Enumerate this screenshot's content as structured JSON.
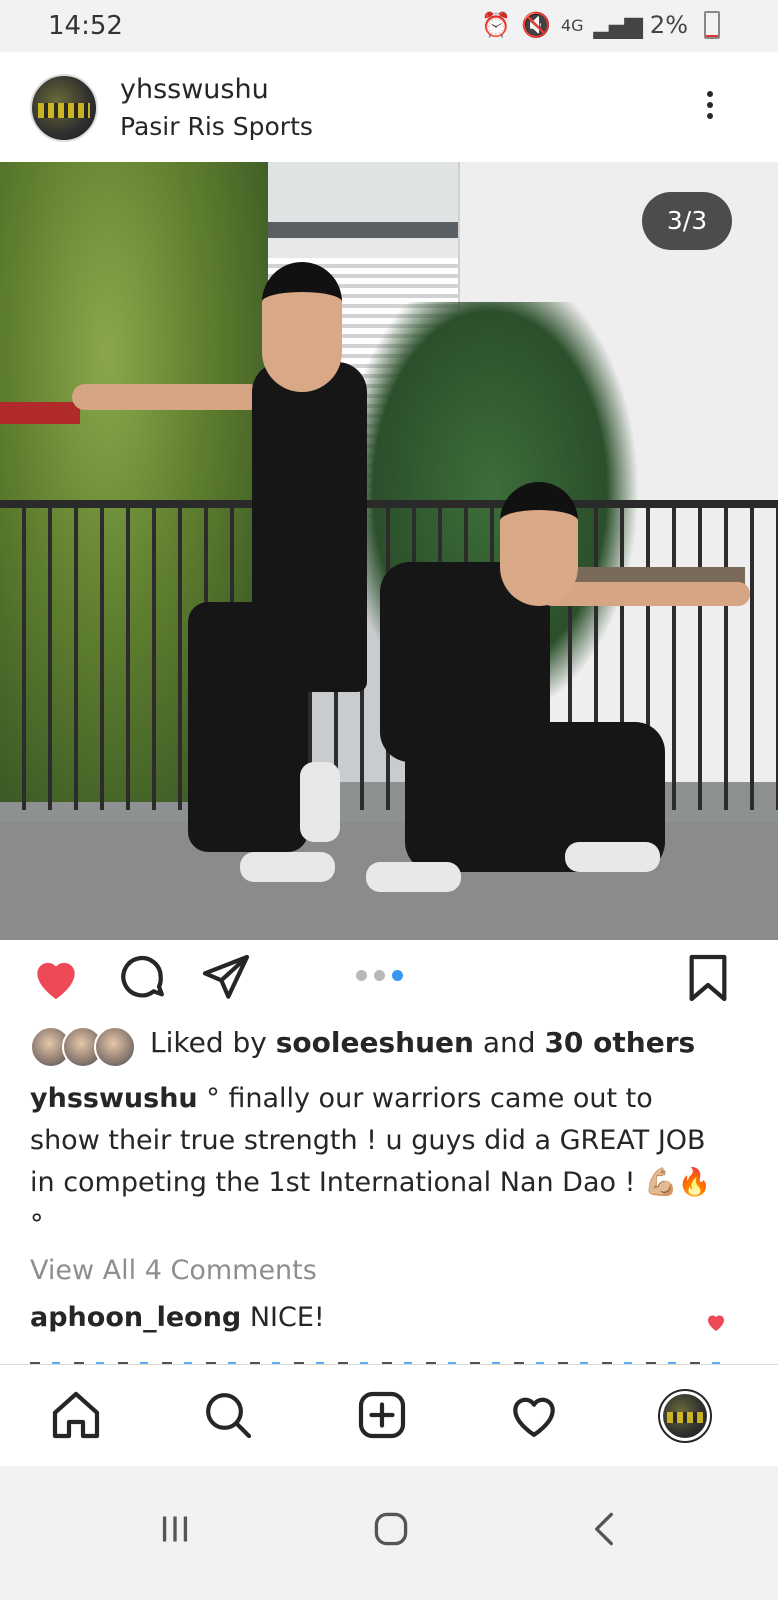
{
  "status_bar": {
    "time": "14:52",
    "network": "4G",
    "battery": "2%"
  },
  "post": {
    "username": "yhsswushu",
    "location": "Pasir Ris Sports",
    "photo_counter": "3/3",
    "carousel": {
      "total": 3,
      "current": 3
    },
    "liked": true,
    "likes": {
      "prefix": "Liked by",
      "user": "sooleeshuen",
      "middle": "and",
      "others": "30 others"
    },
    "caption": {
      "username": "yhsswushu",
      "text": "° finally our warriors came out to show their true strength ! u guys did a GREAT JOB in competing the 1st International Nan Dao ! 💪🏼🔥 °"
    },
    "view_all_comments": "View All 4 Comments",
    "comments": [
      {
        "username": "aphoon_leong",
        "text": "NICE!",
        "liked": true
      }
    ]
  },
  "nav": {
    "items": [
      "home-icon",
      "search-icon",
      "add-post-icon",
      "activity-heart-icon",
      "profile-avatar"
    ],
    "active": "home-icon"
  },
  "colors": {
    "like_red": "#ed4956",
    "link_blue": "#3897f0",
    "text": "#262626",
    "muted": "#8e8e8e"
  }
}
